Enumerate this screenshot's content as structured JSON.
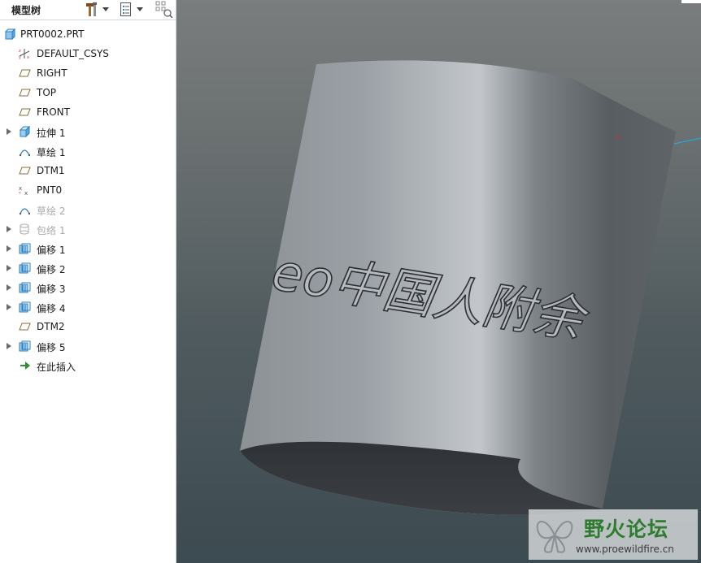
{
  "panel": {
    "title": "模型树"
  },
  "toolbar": {
    "tools_icon": "hammer-wrench-icon",
    "show_icon": "list-settings-icon",
    "filter_icon": "tree-filter-icon"
  },
  "tree": {
    "root": {
      "label": "PRT0002.PRT",
      "icon": "part-icon"
    },
    "items": [
      {
        "label": "DEFAULT_CSYS",
        "icon": "csys-icon",
        "expandable": false,
        "suppressed": false
      },
      {
        "label": "RIGHT",
        "icon": "datum-plane-icon",
        "expandable": false,
        "suppressed": false
      },
      {
        "label": "TOP",
        "icon": "datum-plane-icon",
        "expandable": false,
        "suppressed": false
      },
      {
        "label": "FRONT",
        "icon": "datum-plane-icon",
        "expandable": false,
        "suppressed": false
      },
      {
        "label": "拉伸 1",
        "icon": "extrude-icon",
        "expandable": true,
        "suppressed": false
      },
      {
        "label": "草绘 1",
        "icon": "sketch-icon",
        "expandable": false,
        "suppressed": false
      },
      {
        "label": "DTM1",
        "icon": "datum-plane-icon",
        "expandable": false,
        "suppressed": false
      },
      {
        "label": "PNT0",
        "icon": "datum-point-icon",
        "expandable": false,
        "suppressed": false
      },
      {
        "label": "草绘 2",
        "icon": "sketch-icon",
        "expandable": false,
        "suppressed": true
      },
      {
        "label": "包络 1",
        "icon": "wrap-icon",
        "expandable": true,
        "suppressed": true
      },
      {
        "label": "偏移 1",
        "icon": "offset-icon",
        "expandable": true,
        "suppressed": false
      },
      {
        "label": "偏移 2",
        "icon": "offset-icon",
        "expandable": true,
        "suppressed": false
      },
      {
        "label": "偏移 3",
        "icon": "offset-icon",
        "expandable": true,
        "suppressed": false
      },
      {
        "label": "偏移 4",
        "icon": "offset-icon",
        "expandable": true,
        "suppressed": false
      },
      {
        "label": "DTM2",
        "icon": "datum-plane-icon",
        "expandable": false,
        "suppressed": false
      },
      {
        "label": "偏移 5",
        "icon": "offset-icon",
        "expandable": true,
        "suppressed": false
      },
      {
        "label": "在此插入",
        "icon": "insert-here-arrow-icon",
        "expandable": false,
        "suppressed": false
      }
    ]
  },
  "model": {
    "embossed_text": "eo中国人附余"
  },
  "watermark": {
    "title": "野火论坛",
    "url": "www.proewildfire.cn",
    "logo_icon": "butterfly-logo-icon"
  },
  "colors": {
    "tree_icon_blue": "#2f7fc1",
    "insert_arrow_green": "#2f8f2f",
    "suppressed_gray": "#a9a9a9",
    "watermark_green": "#2e7c2e"
  }
}
